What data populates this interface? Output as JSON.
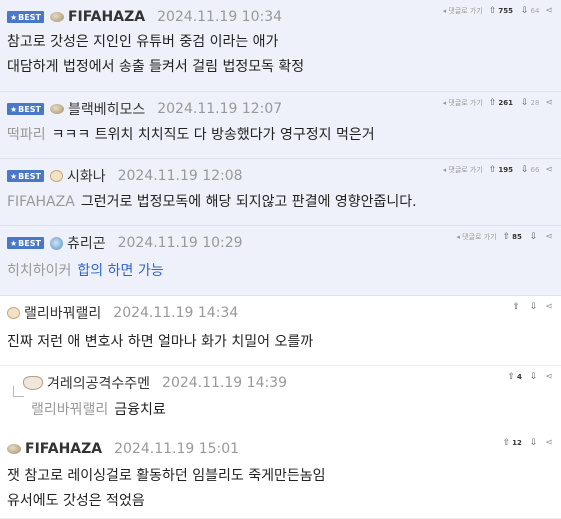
{
  "labels": {
    "best": "BEST",
    "reply": "댓글로 가기"
  },
  "comments": [
    {
      "type": "best",
      "avatar": "pebble",
      "nick": "FIFAHAZA",
      "nick_bold": true,
      "date": "2024.11.19 10:34",
      "up": "755",
      "down": "64",
      "prefix": "",
      "lines": [
        "참고로 갓성은 지인인 유튜버 중검 이라는 애가",
        "대담하게 법정에서 송출 들켜서 걸림 법정모독 확정"
      ]
    },
    {
      "type": "best",
      "avatar": "pebble",
      "nick": "블랙베히모스",
      "nick_bold": false,
      "date": "2024.11.19 12:07",
      "up": "261",
      "down": "28",
      "prefix": "떡파리",
      "lines": [
        "ㅋㅋㅋ 트위치 치치직도 다 방송했다가 영구정지 먹은거"
      ]
    },
    {
      "type": "best",
      "avatar": "face",
      "nick": "시화나",
      "nick_bold": false,
      "date": "2024.11.19 12:08",
      "up": "195",
      "down": "66",
      "prefix": "FIFAHAZA",
      "lines": [
        "그런거로 법정모독에 해당 되지않고 판결에 영향안줍니다."
      ]
    },
    {
      "type": "best",
      "avatar": "globe",
      "nick": "츄리곤",
      "nick_bold": false,
      "date": "2024.11.19 10:29",
      "up": "85",
      "down": "",
      "prefix": "히치하이커",
      "lines": [
        "합의 하면 가능"
      ]
    },
    {
      "type": "normal",
      "avatar": "face",
      "nick": "랠리바꿔랠리",
      "nick_bold": false,
      "date": "2024.11.19 14:34",
      "up": "",
      "down": "",
      "prefix": "",
      "lines": [
        "진짜 저런 애 변호사 하면 얼마나 화가 치밀어 오를까"
      ]
    },
    {
      "type": "reply",
      "avatar": "cow",
      "nick": "겨레의공격수주멘",
      "nick_bold": false,
      "date": "2024.11.19 14:39",
      "up": "4",
      "down": "",
      "prefix": "랠리바꿔랠리",
      "lines": [
        "금융치료"
      ]
    },
    {
      "type": "normal",
      "avatar": "pebble",
      "nick": "FIFAHAZA",
      "nick_bold": true,
      "date": "2024.11.19 15:01",
      "up": "12",
      "down": "",
      "prefix": "",
      "lines": [
        "잿 참고로 레이싱걸로 활동하던 임블리도 죽게만든놈임",
        "유서에도 갓성은 적었음"
      ]
    }
  ]
}
